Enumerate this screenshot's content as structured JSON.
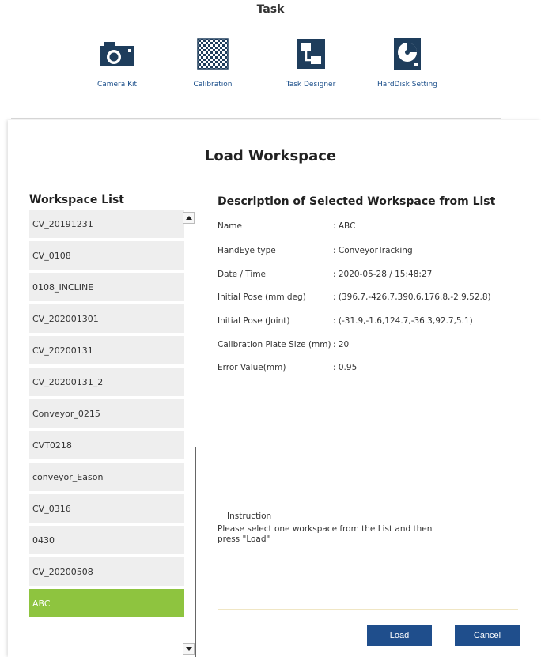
{
  "header": {
    "title": "Task"
  },
  "toolbar": {
    "items": [
      {
        "label": "Camera Kit",
        "icon": "camera-icon"
      },
      {
        "label": "Calibration",
        "icon": "checkerboard-icon"
      },
      {
        "label": "Task Designer",
        "icon": "flowchart-icon"
      },
      {
        "label": "HardDisk Setting",
        "icon": "harddisk-icon"
      }
    ]
  },
  "dialog": {
    "title": "Load Workspace",
    "workspace_list": {
      "heading": "Workspace List",
      "items": [
        "CV_20191231",
        "CV_0108",
        "0108_INCLINE",
        "CV_202001301",
        "CV_20200131",
        "CV_20200131_2",
        "Conveyor_0215",
        "CVT0218",
        "conveyor_Eason",
        "CV_0316",
        "0430",
        "CV_20200508",
        "ABC"
      ],
      "selected": "ABC"
    },
    "description": {
      "heading": "Description of Selected Workspace from List",
      "rows": [
        {
          "label": "Name",
          "value": ": ABC"
        },
        {
          "label": "HandEye type",
          "value": ": ConveyorTracking"
        },
        {
          "label": "Date / Time",
          "value": ": 2020-05-28 / 15:48:27"
        },
        {
          "label": "Initial Pose (mm deg)",
          "value": ": (396.7,-426.7,390.6,176.8,-2.9,52.8)"
        },
        {
          "label": "Initial Pose (Joint)",
          "value": ": (-31.9,-1.6,124.7,-36.3,92.7,5.1)"
        },
        {
          "label": "Calibration Plate Size (mm)",
          "value": ": 20"
        },
        {
          "label": "Error Value(mm)",
          "value": ": 0.95"
        }
      ]
    },
    "instruction": {
      "title": "Instruction",
      "text": "Please select one workspace from the List and then press \"Load\""
    },
    "buttons": {
      "load": "Load",
      "cancel": "Cancel"
    }
  },
  "colors": {
    "accent": "#1f4e8c",
    "selected": "#8ec43f",
    "item_bg": "#eeeeee",
    "icon": "#1e3d5c"
  }
}
